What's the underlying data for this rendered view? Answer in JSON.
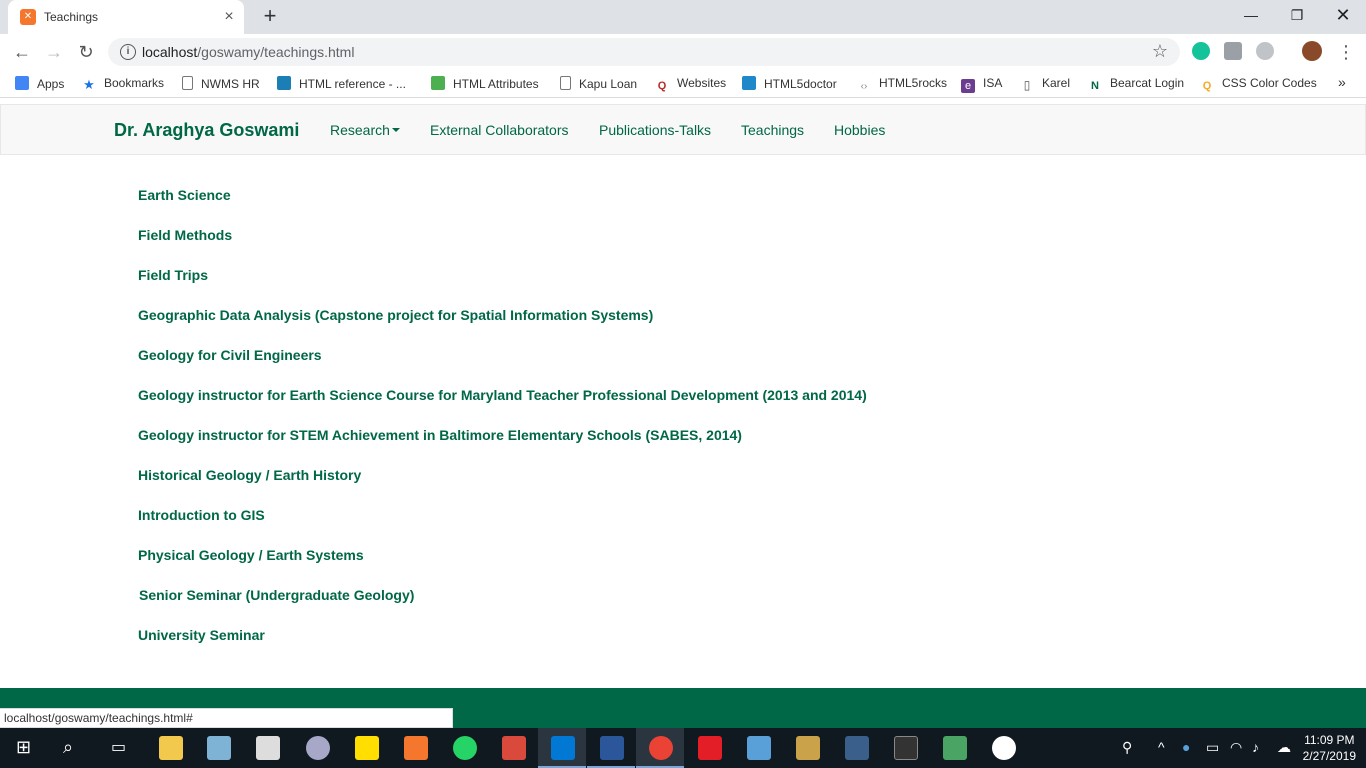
{
  "browser": {
    "tab_title": "Teachings",
    "tab_favicon": "✕",
    "url_host": "localhost",
    "url_path": "/goswamy/teachings.html",
    "status_url": "localhost/goswamy/teachings.html#"
  },
  "bookmarks": [
    {
      "label": "Apps",
      "icon": "apps-grid-icon",
      "color": "#4285f4"
    },
    {
      "label": "Bookmarks",
      "icon": "star-icon",
      "color": "#1a73e8"
    },
    {
      "label": "NWMS HR",
      "icon": "page-icon",
      "color": "#ffffff"
    },
    {
      "label": "HTML reference - ...",
      "icon": "mdn-icon",
      "color": "#1b7fb5"
    },
    {
      "label": "HTML Attributes",
      "icon": "w3-icon",
      "color": "#4caf50"
    },
    {
      "label": "Kapu Loan",
      "icon": "page-icon",
      "color": "#ffffff"
    },
    {
      "label": "Websites",
      "icon": "q-icon",
      "color": "#b92b27"
    },
    {
      "label": "HTML5doctor",
      "icon": "html5doctor-icon",
      "color": "#1e88c8"
    },
    {
      "label": "HTML5rocks",
      "icon": "html5rocks-icon",
      "color": "#888888"
    },
    {
      "label": "ISA",
      "icon": "e-icon",
      "color": "#6a3d8f"
    },
    {
      "label": "Karel",
      "icon": "book-icon",
      "color": "#555555"
    },
    {
      "label": "Bearcat Login",
      "icon": "n-icon",
      "color": "#006747"
    },
    {
      "label": "CSS Color Codes",
      "icon": "search-color-icon",
      "color": "#f9a825"
    }
  ],
  "site": {
    "brand": "Dr. Araghya Goswami",
    "nav": [
      "Research",
      "External Collaborators",
      "Publications-Talks",
      "Teachings",
      "Hobbies"
    ],
    "accent_color": "#006747"
  },
  "courses": [
    "Earth Science",
    "Field Methods",
    "Field Trips",
    "Geographic Data Analysis (Capstone project for Spatial Information Systems)",
    "Geology for Civil Engineers",
    "Geology instructor for Earth Science Course for Maryland Teacher Professional Development (2013 and 2014)",
    "Geology instructor for STEM Achievement in Baltimore Elementary Schools (SABES, 2014)",
    "Historical Geology / Earth History",
    "Introduction to GIS",
    "Physical Geology / Earth Systems",
    "Senior Seminar (Undergraduate Geology)",
    "University Seminar"
  ],
  "taskbar": {
    "time": "11:09 PM",
    "date": "2/27/2019"
  }
}
